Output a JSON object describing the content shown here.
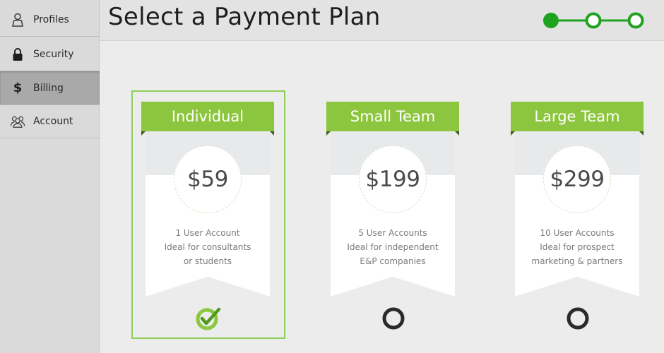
{
  "sidebar": {
    "items": [
      {
        "label": "Profiles",
        "icon": "user-icon"
      },
      {
        "label": "Security",
        "icon": "lock-icon"
      },
      {
        "label": "Billing",
        "icon": "dollar-icon",
        "active": true
      },
      {
        "label": "Account",
        "icon": "group-icon"
      }
    ]
  },
  "header": {
    "title": "Select a Payment Plan",
    "stepper": {
      "steps": 3,
      "current_step": 1
    }
  },
  "plans": [
    {
      "name": "Individual",
      "price": "$59",
      "desc_line1": "1 User Account",
      "desc_line2": "Ideal for consultants",
      "desc_line3": "or students",
      "selected": true
    },
    {
      "name": "Small Team",
      "price": "$199",
      "desc_line1": "5 User Accounts",
      "desc_line2": "Ideal for independent",
      "desc_line3": "E&P companies",
      "selected": false
    },
    {
      "name": "Large Team",
      "price": "$299",
      "desc_line1": "10 User Accounts",
      "desc_line2": "Ideal for prospect",
      "desc_line3": "marketing & partners",
      "selected": false
    }
  ],
  "colors": {
    "accent_green": "#8cc63f",
    "stepper_green": "#1fa21f",
    "sidebar_bg": "#dadada",
    "active_item_bg": "#a9a9a9"
  }
}
